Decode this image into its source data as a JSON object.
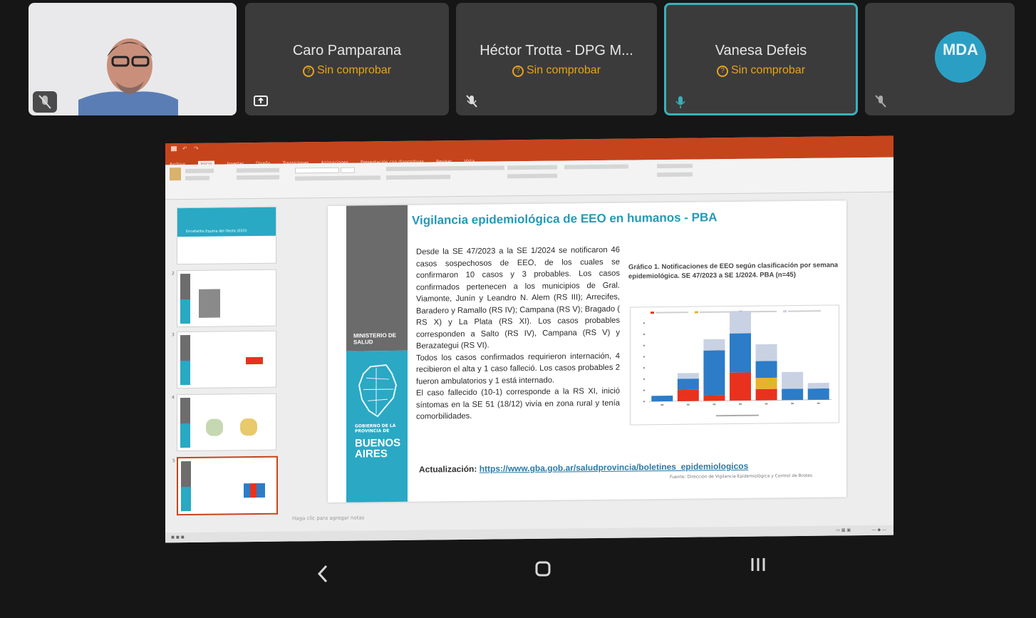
{
  "participants": [
    {
      "name": "Caro Pamparana",
      "status": "Sin comprobar",
      "corner_icon": "screen-share-icon"
    },
    {
      "name": "Héctor Trotta - DPG M...",
      "status": "Sin comprobar",
      "corner_icon": "mic-off-icon"
    },
    {
      "name": "Vanesa Defeis",
      "status": "Sin comprobar",
      "corner_icon": "mic-on-icon"
    }
  ],
  "avatar_tile": {
    "initials": "MDA"
  },
  "colors": {
    "accent_active": "#3ab0b8",
    "status_warning": "#e8a31b",
    "ppt_orange": "#c6441c",
    "slide_blue": "#2aa8c4"
  },
  "slide": {
    "title": "Vigilancia epidemiológica de EEO en humanos - PBA",
    "ministerio": [
      "MINISTERIO DE",
      "SALUD"
    ],
    "gobierno": [
      "GOBIERNO DE LA",
      "PROVINCIA DE"
    ],
    "buenos_aires": [
      "BUENOS",
      "AIRES"
    ],
    "body": [
      "Desde la SE 47/2023 a la SE 1/2024 se notificaron 46 casos sospechosos de EEO, de los cuales se confirmaron 10 casos y 3 probables. Los casos confirmados pertenecen a los municipios de Gral. Viamonte, Junín y Leandro N. Alem (RS III); Arrecifes, Baradero y Ramallo (RS IV); Campana (RS V); Bragado ( RS X) y La Plata (RS XI). Los casos probables corresponden a Salto (RS IV), Campana (RS V) y Berazategui (RS VI).",
      "Todos los casos confirmados requirieron internación, 4 recibieron el alta y 1 caso falleció. Los casos probables 2 fueron ambulatorios y 1 está internado.",
      "El caso fallecido (10-1) corresponde a la RS XI, inició síntomas en la SE 51 (18/12) vivía en zona rural y tenía comorbilidades."
    ],
    "chart_caption": "Gráfico 1. Notificaciones de EEO según clasificación por semana epidemiológica. SE 47/2023 a SE 1/2024. PBA (n=45)",
    "update_label": "Actualización:",
    "update_link": "https://www.gba.gob.ar/saludprovincia/boletines_epidemiologicos",
    "source": "Fuente: Dirección de Vigilancia Epidemiológica y Control de Brotes"
  },
  "ppt": {
    "notes_placeholder": "Haga clic para agregar notas",
    "tabs": [
      "Archivo",
      "Inicio",
      "Insertar",
      "Diseño",
      "Transiciones",
      "Animaciones",
      "Presentación con diapositivas",
      "Revisar",
      "Vista"
    ],
    "thumb_count": 5,
    "first_thumb_title": "Encefalitis Equina del Oeste (EEO)"
  },
  "chart_data": {
    "type": "bar",
    "stacked": true,
    "categories": [
      "47",
      "48",
      "49",
      "50",
      "51",
      "52",
      "1"
    ],
    "series": [
      {
        "color": "#e8321e",
        "values": [
          0,
          2,
          1,
          5,
          2,
          0,
          0
        ]
      },
      {
        "color": "#e8b22c",
        "values": [
          0,
          0,
          0,
          0,
          2,
          0,
          0
        ]
      },
      {
        "color": "#2c7cc8",
        "values": [
          1,
          2,
          8,
          7,
          3,
          2,
          2
        ]
      },
      {
        "color": "#c9d2e3",
        "values": [
          0,
          1,
          2,
          4,
          3,
          3,
          1
        ]
      }
    ],
    "ylim": [
      0,
      14
    ]
  }
}
